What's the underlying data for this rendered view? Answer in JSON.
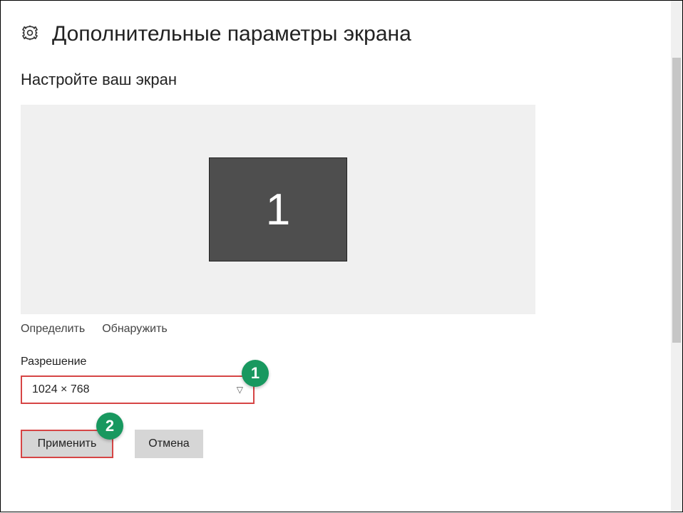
{
  "header": {
    "title": "Дополнительные параметры экрана"
  },
  "section": {
    "customize_title": "Настройте ваш экран"
  },
  "monitor": {
    "number": "1"
  },
  "links": {
    "identify": "Определить",
    "detect": "Обнаружить"
  },
  "resolution": {
    "label": "Разрешение",
    "value": "1024 × 768"
  },
  "buttons": {
    "apply": "Применить",
    "cancel": "Отмена"
  },
  "annotations": {
    "badge1": "1",
    "badge2": "2"
  }
}
